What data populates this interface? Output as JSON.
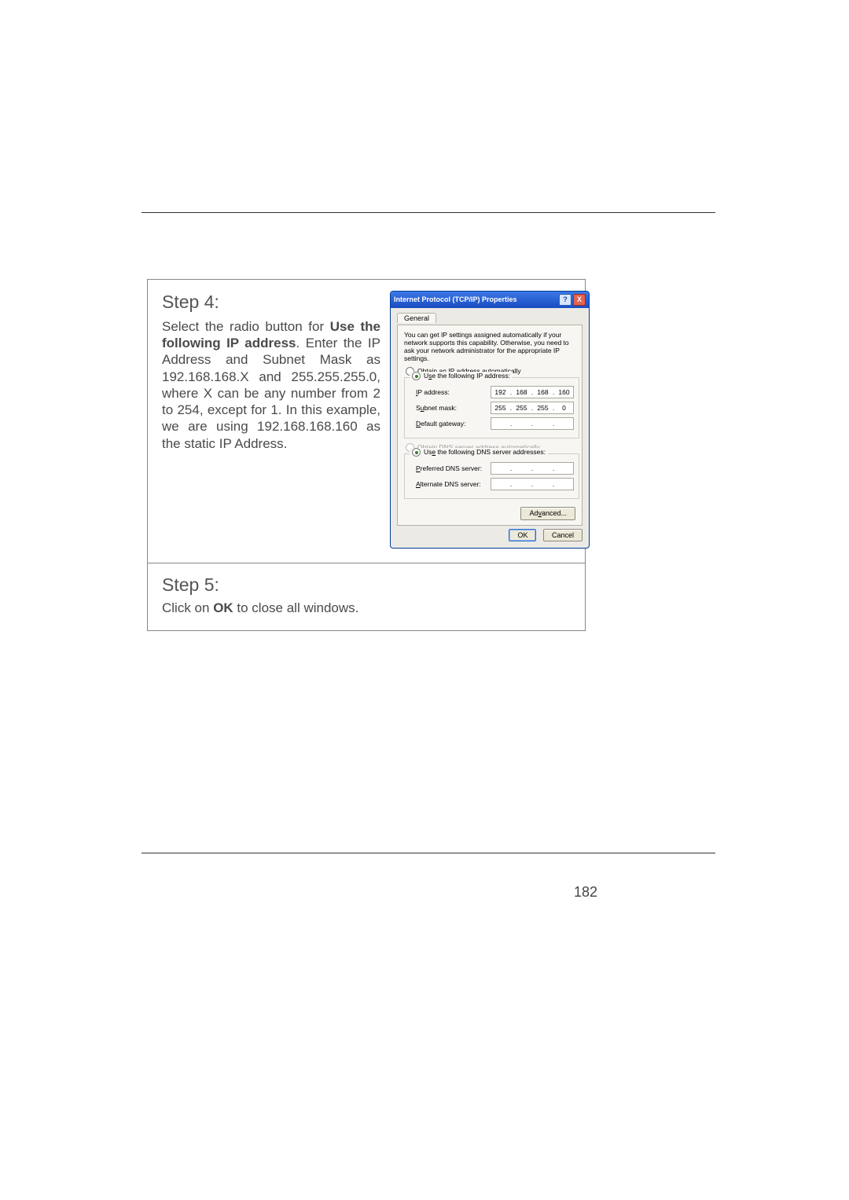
{
  "page_number": "182",
  "step4": {
    "title": "Step 4:",
    "body_pre": "Select the radio button for ",
    "body_bold1": "Use the following IP address",
    "body_mid": ". Enter the IP Address and Subnet Mask as 192.168.168.X and 255.255.255.0, where X can be any number from 2 to 254, except for 1. In this example, we are using 192.168.168.160 as the static IP Address."
  },
  "step5": {
    "title": "Step 5:",
    "body_pre": "Click on ",
    "body_bold": "OK",
    "body_post": " to close all windows."
  },
  "dialog": {
    "title": "Internet Protocol (TCP/IP) Properties",
    "help_icon": "?",
    "close_icon": "X",
    "tab_general": "General",
    "intro": "You can get IP settings assigned automatically if your network supports this capability. Otherwise, you need to ask your network administrator for the appropriate IP settings.",
    "radio_obtain_ip": "Obtain an IP address automatically",
    "radio_use_ip": "Use the following IP address:",
    "label_ip": "IP address:",
    "label_subnet": "Subnet mask:",
    "label_gateway": "Default gateway:",
    "radio_obtain_dns": "Obtain DNS server address automatically",
    "radio_use_dns": "Use the following DNS server addresses:",
    "label_pref_dns": "Preferred DNS server:",
    "label_alt_dns": "Alternate DNS server:",
    "btn_advanced": "Advanced...",
    "btn_ok": "OK",
    "btn_cancel": "Cancel",
    "ip": {
      "a": "192",
      "b": "168",
      "c": "168",
      "d": "160"
    },
    "mask": {
      "a": "255",
      "b": "255",
      "c": "255",
      "d": "0"
    },
    "gateway": {
      "a": "",
      "b": "",
      "c": "",
      "d": ""
    },
    "prefdns": {
      "a": "",
      "b": "",
      "c": "",
      "d": ""
    },
    "altdns": {
      "a": "",
      "b": "",
      "c": "",
      "d": ""
    }
  }
}
